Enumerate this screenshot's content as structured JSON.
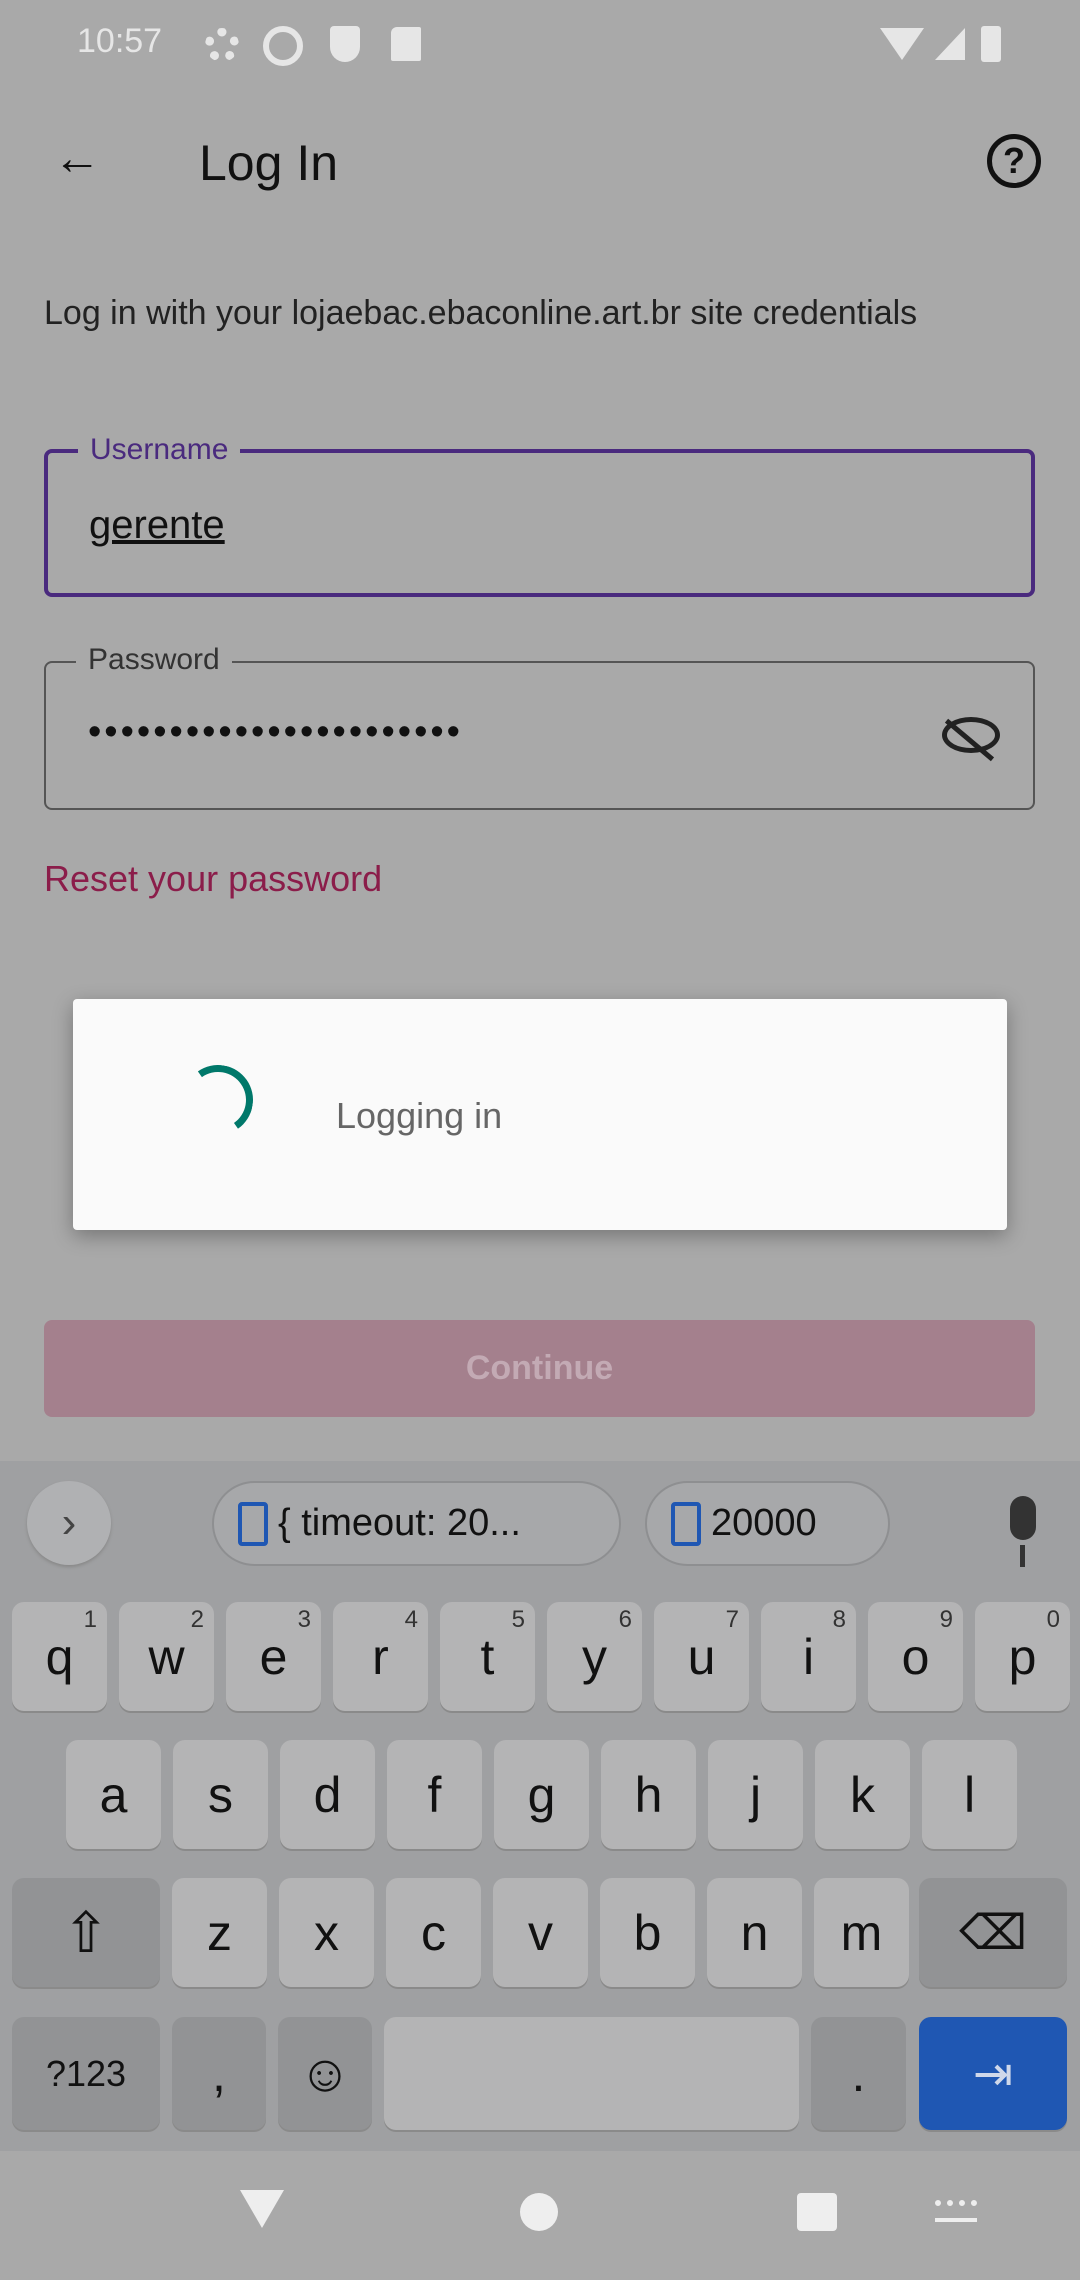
{
  "status_bar": {
    "time": "10:57"
  },
  "toolbar": {
    "title": "Log In"
  },
  "description": "Log in with your lojaebac.ebaconline.art.br site credentials",
  "username": {
    "label": "Username",
    "value": "gerente"
  },
  "password": {
    "label": "Password",
    "value": "•••••••••••••••••••••••"
  },
  "reset_link": "Reset your password",
  "dialog": {
    "message": "Logging in"
  },
  "continue_label": "Continue",
  "keyboard": {
    "suggestions": [
      "{ timeout: 20...",
      "20000"
    ],
    "row1": [
      {
        "k": "q",
        "h": "1"
      },
      {
        "k": "w",
        "h": "2"
      },
      {
        "k": "e",
        "h": "3"
      },
      {
        "k": "r",
        "h": "4"
      },
      {
        "k": "t",
        "h": "5"
      },
      {
        "k": "y",
        "h": "6"
      },
      {
        "k": "u",
        "h": "7"
      },
      {
        "k": "i",
        "h": "8"
      },
      {
        "k": "o",
        "h": "9"
      },
      {
        "k": "p",
        "h": "0"
      }
    ],
    "row2": [
      "a",
      "s",
      "d",
      "f",
      "g",
      "h",
      "j",
      "k",
      "l"
    ],
    "row3": [
      "z",
      "x",
      "c",
      "v",
      "b",
      "n",
      "m"
    ],
    "symbols": "?123",
    "comma": ",",
    "period": "."
  },
  "colors": {
    "accent": "#4a2a7e",
    "link": "#8b1d4a",
    "spinner": "#00786a",
    "enter": "#1f57b3"
  }
}
